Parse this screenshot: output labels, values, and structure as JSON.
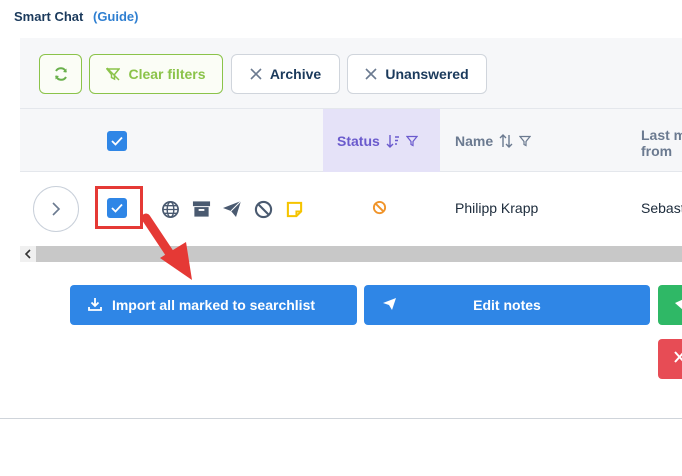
{
  "header": {
    "app_title": "Smart Chat",
    "guide_link": "(Guide)"
  },
  "toolbar": {
    "refresh_icon": "refresh-icon",
    "clear_filters_label": "Clear filters",
    "archive_label": "Archive",
    "unanswered_label": "Unanswered"
  },
  "table": {
    "columns": {
      "status": "Status",
      "name": "Name",
      "last_message_line1": "Last m",
      "last_message_line2": "from"
    },
    "rows": [
      {
        "name": "Philipp Krapp",
        "last_message": "Sebast",
        "status_icon": "blocked-icon",
        "checked": true
      }
    ]
  },
  "actions": {
    "import_label": "Import all marked to searchlist",
    "edit_notes_label": "Edit notes"
  },
  "colors": {
    "primary_blue": "#2f86e6",
    "green": "#8bc34a",
    "status_highlight": "#e5e2f8",
    "annotation_red": "#e53935"
  }
}
